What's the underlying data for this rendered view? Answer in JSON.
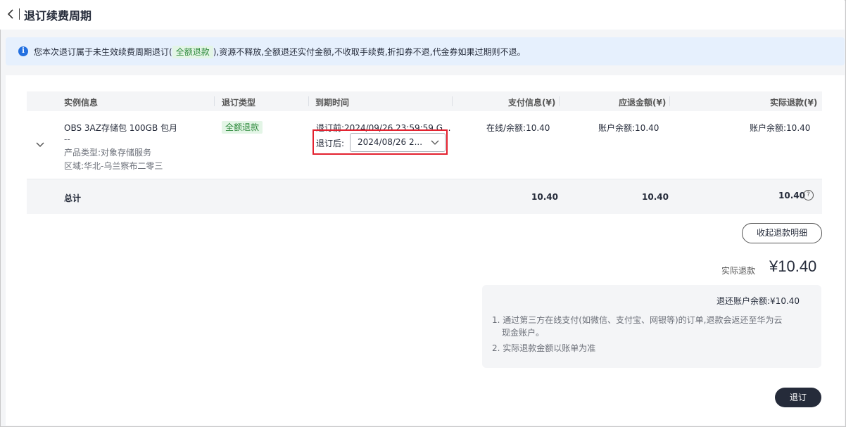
{
  "header": {
    "title": "退订续费周期"
  },
  "notice": {
    "text_before": "您本次退订属于未生效续费周期退订(",
    "tag": "全额退款",
    "text_after": "),资源不释放,全额退还实付金额,不收取手续费,折扣券不退,代金券如果过期则不退。"
  },
  "table": {
    "columns": [
      "实例信息",
      "退订类型",
      "到期时间",
      "支付信息(¥)",
      "应退金额(¥)",
      "实际退款(¥)"
    ],
    "row": {
      "name": "OBS 3AZ存储包 100GB 包月",
      "dash": "--",
      "product_type": "产品类型:对象存储服务",
      "region": "区域:华北-乌兰察布二零三",
      "refund_type": "全额退款",
      "before_label": "退订前:2024/09/26 23:59:59 G...",
      "after_label": "退订后:",
      "after_value": "2024/08/26 2...",
      "payment": "在线/余额:10.40",
      "should_refund": "账户余额:10.40",
      "actual_refund": "账户余额:10.40"
    },
    "total": {
      "label": "总计",
      "payment": "10.40",
      "should_refund": "10.40",
      "actual_refund": "10.40",
      "help": "?"
    }
  },
  "collapse_button": "收起退款明细",
  "refund": {
    "label": "实际退款",
    "amount": "¥10.40",
    "account_line": "退还账户余额:¥10.40",
    "note1_line1": "1. 通过第三方在线支付(如微信、支付宝、网银等)的订单,退款会返还至华为云",
    "note1_line2": "现金账户。",
    "note2": "2. 实际退款金额以账单为准"
  },
  "submit_button": "退订"
}
